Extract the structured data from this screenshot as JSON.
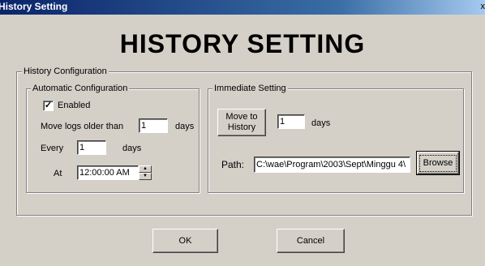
{
  "window": {
    "title": "History Setting"
  },
  "heading": "HISTORY SETTING",
  "history_configuration": {
    "legend": "History Configuration",
    "automatic": {
      "legend": "Automatic Configuration",
      "enabled_label": "Enabled",
      "enabled_checked": true,
      "check_mark": "✓",
      "move_logs_label": "Move logs older than",
      "move_logs_value": "1",
      "move_logs_unit": "days",
      "every_label": "Every",
      "every_value": "1",
      "every_unit": "days",
      "at_label": "At",
      "at_value": "12:00:00 AM",
      "spin_up": "▲",
      "spin_down": "▼"
    },
    "immediate": {
      "legend": "Immediate Setting",
      "move_button_line1": "Move to",
      "move_button_line2": "History",
      "days_value": "1",
      "days_unit": "days",
      "path_label": "Path:",
      "path_value": "C:\\wae\\Program\\2003\\Sept\\Minggu 4\\",
      "browse_label": "Browse"
    }
  },
  "buttons": {
    "ok": "OK",
    "cancel": "Cancel"
  }
}
